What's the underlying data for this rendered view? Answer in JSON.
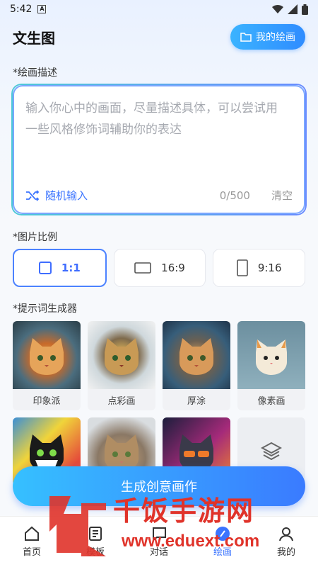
{
  "status": {
    "time": "5:42",
    "notif_letter": "A"
  },
  "header": {
    "title": "文生图",
    "my_drawings": "我的绘画"
  },
  "description": {
    "label": "*绘画描述",
    "placeholder": "输入你心中的画面，尽量描述具体，可以尝试用一些风格修饰词辅助你的表达",
    "random_label": "随机输入",
    "count": "0/500",
    "clear": "清空"
  },
  "ratio": {
    "label": "*图片比例",
    "options": [
      {
        "label": "1:1",
        "active": true
      },
      {
        "label": "16:9",
        "active": false
      },
      {
        "label": "9:16",
        "active": false
      }
    ]
  },
  "prompts": {
    "label": "*提示词生成器",
    "styles": [
      "印象派",
      "点彩画",
      "厚涂",
      "像素画"
    ]
  },
  "generate_button": "生成创意画作",
  "tabs": [
    {
      "label": "首页",
      "active": false
    },
    {
      "label": "模板",
      "active": false
    },
    {
      "label": "对话",
      "active": false
    },
    {
      "label": "绘画",
      "active": true
    },
    {
      "label": "我的",
      "active": false
    }
  ],
  "watermark": {
    "brand": "千饭手游网",
    "url": "www.eduext.com"
  },
  "colors": {
    "accent": "#3b74ff",
    "gradient_start": "#36c0ff"
  }
}
